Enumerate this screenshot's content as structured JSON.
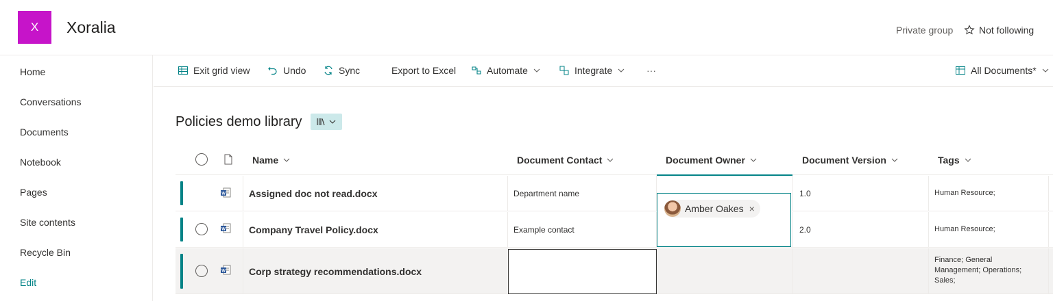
{
  "site": {
    "logo_letter": "X",
    "title": "Xoralia",
    "privacy": "Private group",
    "follow_label": "Not following"
  },
  "nav": {
    "items": [
      "Home",
      "Conversations",
      "Documents",
      "Notebook",
      "Pages",
      "Site contents",
      "Recycle Bin"
    ],
    "edit_label": "Edit"
  },
  "commandbar": {
    "exit_grid": "Exit grid view",
    "undo": "Undo",
    "sync": "Sync",
    "export": "Export to Excel",
    "automate": "Automate",
    "integrate": "Integrate",
    "more": "···",
    "view_selector": "All Documents*"
  },
  "library": {
    "title": "Policies demo library"
  },
  "grid": {
    "columns": {
      "name": "Name",
      "contact": "Document Contact",
      "owner": "Document Owner",
      "version": "Document Version",
      "tags": "Tags"
    },
    "rows": [
      {
        "name": "Assigned doc not read.docx",
        "contact": "Department name",
        "owner": "",
        "version": "1.0",
        "tags": "Human Resource;"
      },
      {
        "name": "Company Travel Policy.docx",
        "contact": "Example contact",
        "owner": "",
        "version": "2.0",
        "tags": "Human Resource;"
      },
      {
        "name": "Corp strategy recommendations.docx",
        "contact": "",
        "owner": "",
        "version": "",
        "tags": "Finance; General Management; Operations; Sales;"
      }
    ]
  },
  "picker": {
    "person_name": "Amber Oakes",
    "remove_glyph": "×"
  },
  "colors": {
    "accent": "#038387",
    "site_logo": "#c614c9",
    "selected_row": "#f3f2f1"
  }
}
